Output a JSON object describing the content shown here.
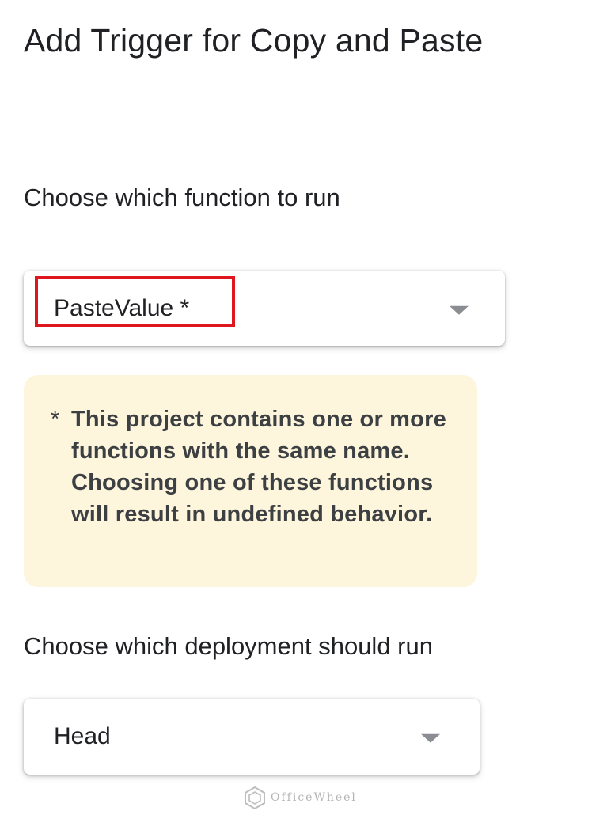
{
  "dialog": {
    "title": "Add Trigger for Copy and Paste"
  },
  "function_section": {
    "label": "Choose which function to run",
    "selected_value": "PasteValue *"
  },
  "warning": {
    "marker": "*",
    "text": "This project contains one or more functions with the same name. Choosing one of these functions will result in undefined behavior."
  },
  "deployment_section": {
    "label": "Choose which deployment should run",
    "selected_value": "Head"
  },
  "watermark": {
    "text": "OfficeWheel"
  },
  "colors": {
    "highlight": "#e0161e",
    "warning_background": "#fdf5dc",
    "text": "#202124"
  },
  "icons": {
    "dropdown": "caret-down-icon",
    "watermark": "officewheel-logo-icon"
  }
}
